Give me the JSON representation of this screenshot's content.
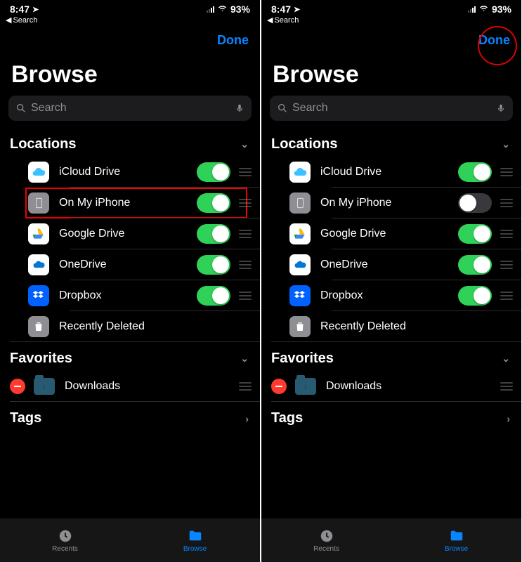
{
  "screens": [
    {
      "status": {
        "time": "8:47",
        "battery": "93%"
      },
      "back": "Search",
      "done": "Done",
      "doneCircled": false,
      "title": "Browse",
      "search": {
        "placeholder": "Search"
      },
      "sections": {
        "locations": {
          "header": "Locations",
          "items": [
            {
              "name": "iCloud Drive",
              "icon": "icloud",
              "toggle": true,
              "highlight": false
            },
            {
              "name": "On My iPhone",
              "icon": "phone",
              "toggle": true,
              "highlight": true
            },
            {
              "name": "Google Drive",
              "icon": "gdrive",
              "toggle": true,
              "highlight": false
            },
            {
              "name": "OneDrive",
              "icon": "onedrive",
              "toggle": true,
              "highlight": false
            },
            {
              "name": "Dropbox",
              "icon": "dropbox",
              "toggle": true,
              "highlight": false
            }
          ],
          "trash": "Recently Deleted"
        },
        "favorites": {
          "header": "Favorites",
          "items": [
            {
              "name": "Downloads"
            }
          ]
        },
        "tags": {
          "header": "Tags"
        }
      },
      "tabs": {
        "recents": "Recents",
        "browse": "Browse"
      }
    },
    {
      "status": {
        "time": "8:47",
        "battery": "93%"
      },
      "back": "Search",
      "done": "Done",
      "doneCircled": true,
      "title": "Browse",
      "search": {
        "placeholder": "Search"
      },
      "sections": {
        "locations": {
          "header": "Locations",
          "items": [
            {
              "name": "iCloud Drive",
              "icon": "icloud",
              "toggle": true,
              "highlight": false
            },
            {
              "name": "On My iPhone",
              "icon": "phone",
              "toggle": false,
              "highlight": false
            },
            {
              "name": "Google Drive",
              "icon": "gdrive",
              "toggle": true,
              "highlight": false
            },
            {
              "name": "OneDrive",
              "icon": "onedrive",
              "toggle": true,
              "highlight": false
            },
            {
              "name": "Dropbox",
              "icon": "dropbox",
              "toggle": true,
              "highlight": false
            }
          ],
          "trash": "Recently Deleted"
        },
        "favorites": {
          "header": "Favorites",
          "items": [
            {
              "name": "Downloads"
            }
          ]
        },
        "tags": {
          "header": "Tags"
        }
      },
      "tabs": {
        "recents": "Recents",
        "browse": "Browse"
      }
    }
  ]
}
